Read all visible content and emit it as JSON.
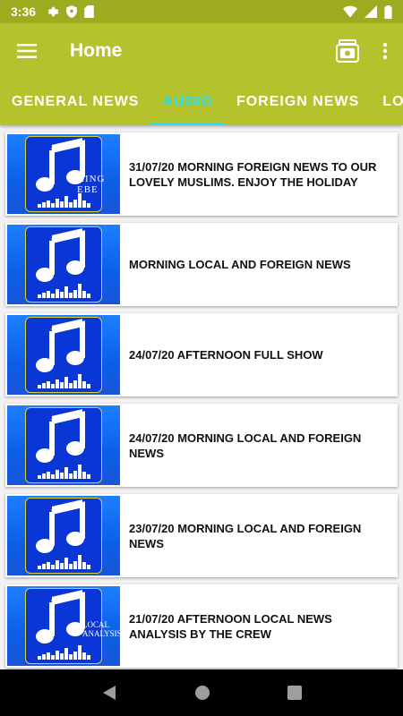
{
  "status_bar": {
    "time": "3:36"
  },
  "app_bar": {
    "title": "Home"
  },
  "tabs": [
    {
      "label": "GENERAL NEWS",
      "active": false
    },
    {
      "label": "AUDIO",
      "active": true
    },
    {
      "label": "FOREIGN NEWS",
      "active": false
    },
    {
      "label": "LOCAL",
      "active": false
    }
  ],
  "items": [
    {
      "title": "31/07/20 MORNING FOREIGN NEWS TO OUR LOVELY MUSLIMS. ENJOY THE HOLIDAY",
      "thumb_overlay": "KING EBE"
    },
    {
      "title": "MORNING LOCAL AND FOREIGN NEWS",
      "thumb_overlay": ""
    },
    {
      "title": "24/07/20 AFTERNOON FULL SHOW",
      "thumb_overlay": ""
    },
    {
      "title": "24/07/20 MORNING LOCAL AND FOREIGN NEWS",
      "thumb_overlay": ""
    },
    {
      "title": "23/07/20 MORNING LOCAL AND FOREIGN NEWS",
      "thumb_overlay": ""
    },
    {
      "title": "21/07/20 AFTERNOON LOCAL NEWS ANALYSIS BY THE CREW",
      "thumb_overlay": "LOCAL ANALYSIS"
    }
  ],
  "colors": {
    "app_bar": "#b4c22e",
    "status_bar": "#9cab1f",
    "tab_active": "#22e0f2",
    "thumb_blue": "#1e7fff"
  },
  "icons": [
    "settings-icon",
    "shield-icon",
    "sd-card-icon",
    "wifi-icon",
    "signal-icon",
    "battery-icon",
    "menu-icon",
    "radio-icon",
    "more-vert-icon",
    "music-note-icon",
    "back-icon",
    "home-icon",
    "recents-icon"
  ]
}
